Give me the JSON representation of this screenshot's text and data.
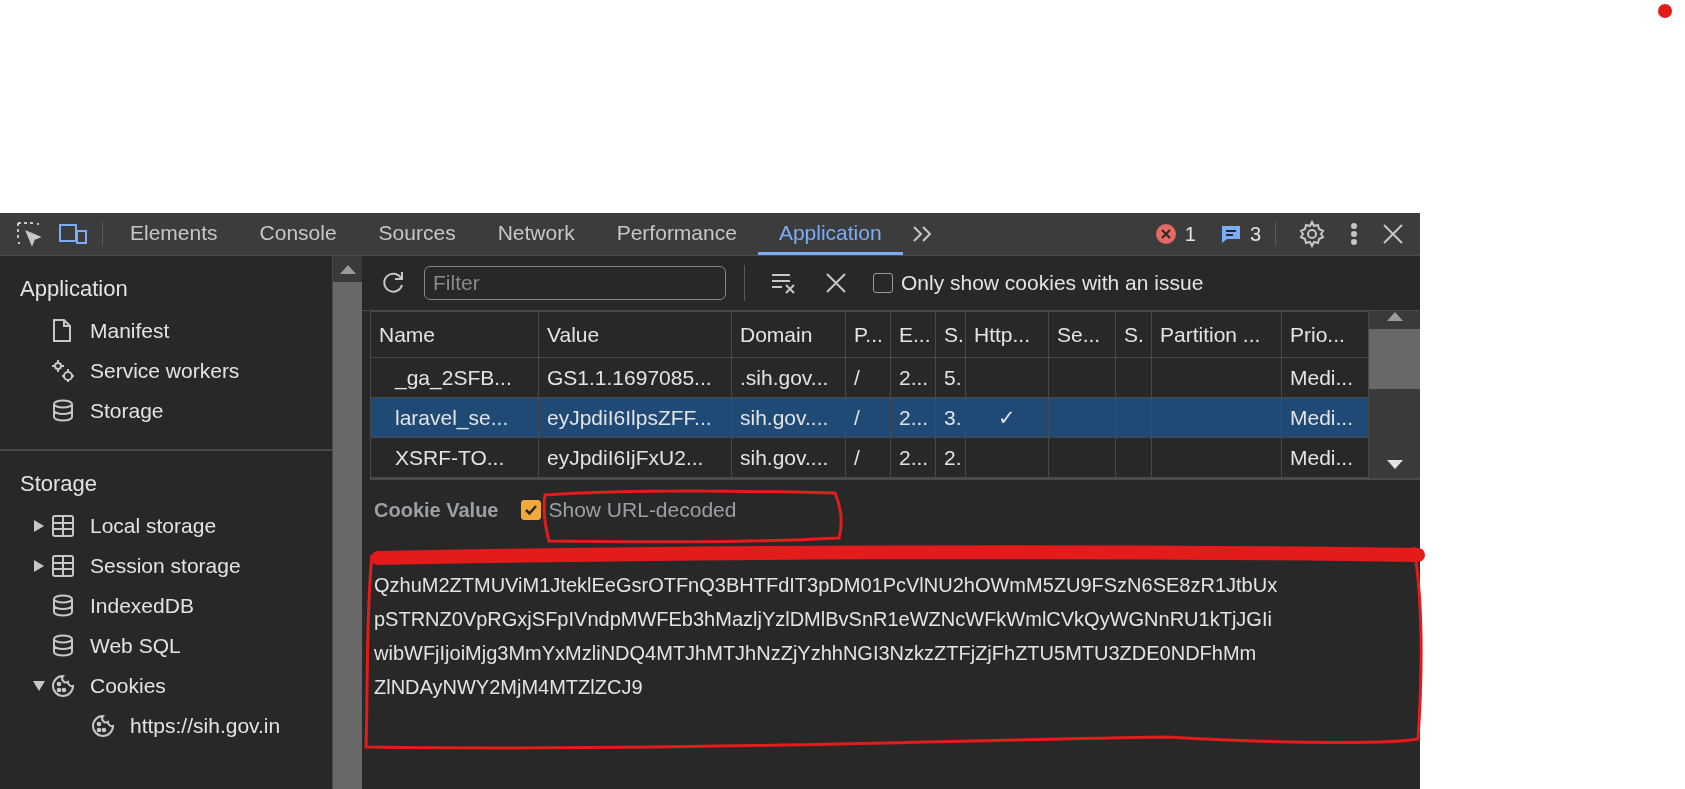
{
  "toolbar": {
    "tabs": [
      {
        "label": "Elements",
        "selected": false
      },
      {
        "label": "Console",
        "selected": false
      },
      {
        "label": "Sources",
        "selected": false
      },
      {
        "label": "Network",
        "selected": false
      },
      {
        "label": "Performance",
        "selected": false
      },
      {
        "label": "Application",
        "selected": true
      }
    ],
    "error_count": "1",
    "message_count": "3"
  },
  "sidebar": {
    "sections": [
      {
        "title": "Application",
        "items": [
          {
            "label": "Manifest",
            "kind": "file"
          },
          {
            "label": "Service workers",
            "kind": "gears"
          },
          {
            "label": "Storage",
            "kind": "database"
          }
        ]
      },
      {
        "title": "Storage",
        "items": [
          {
            "label": "Local storage",
            "kind": "table",
            "expanded": false
          },
          {
            "label": "Session storage",
            "kind": "table",
            "expanded": false
          },
          {
            "label": "IndexedDB",
            "kind": "database"
          },
          {
            "label": "Web SQL",
            "kind": "database"
          },
          {
            "label": "Cookies",
            "kind": "cookie",
            "expanded": true,
            "children": [
              {
                "label": "https://sih.gov.in",
                "kind": "cookie"
              }
            ]
          }
        ]
      }
    ]
  },
  "cookie_toolbar": {
    "filter": {
      "placeholder": "Filter"
    },
    "issue_filter": {
      "label": "Only show cookies with an issue",
      "checked": false
    }
  },
  "table": {
    "columns": [
      "Name",
      "Value",
      "Domain",
      "P...",
      "E...",
      "S.",
      "Http...",
      "Se...",
      "S.",
      "Partition ...",
      "Prio..."
    ],
    "rows": [
      {
        "selected": false,
        "cells": [
          "_ga_2SFB...",
          "GS1.1.1697085...",
          ".sih.gov...",
          "/",
          "2...",
          "5.",
          "",
          "",
          "",
          "",
          "Medi..."
        ]
      },
      {
        "selected": true,
        "cells": [
          "laravel_se...",
          "eyJpdiI6IlpsZFF...",
          "sih.gov....",
          "/",
          "2...",
          "3.",
          "✓",
          "",
          "",
          "",
          "Medi..."
        ]
      },
      {
        "selected": false,
        "cells": [
          "XSRF-TO...",
          "eyJpdiI6IjFxU2...",
          "sih.gov....",
          "/",
          "2...",
          "2.",
          "",
          "",
          "",
          "",
          "Medi..."
        ]
      }
    ]
  },
  "cookie_value": {
    "title": "Cookie Value",
    "url_decoded": {
      "label": "Show URL-decoded",
      "checked": true
    },
    "lines": [
      "QzhuM2ZTMUViM1JteklEeGsrOTFnQ3BHTFdIT3pDM01PcVlNU2hOWmM5ZU9FSzN6SE8zR1JtbUx",
      "pSTRNZ0VpRGxjSFpIVndpMWFEb3hMazljYzlDMlBvSnR1eWZNcWFkWmlCVkQyWGNnRU1kTjJGIi",
      "wibWFjIjoiMjg3MmYxMzliNDQ4MTJhMTJhNzZjYzhhNGI3NzkzZTFjZjFhZTU5MTU3ZDE0NDFhMm",
      "ZlNDAyNWY2MjM4MTZlZCJ9"
    ]
  }
}
